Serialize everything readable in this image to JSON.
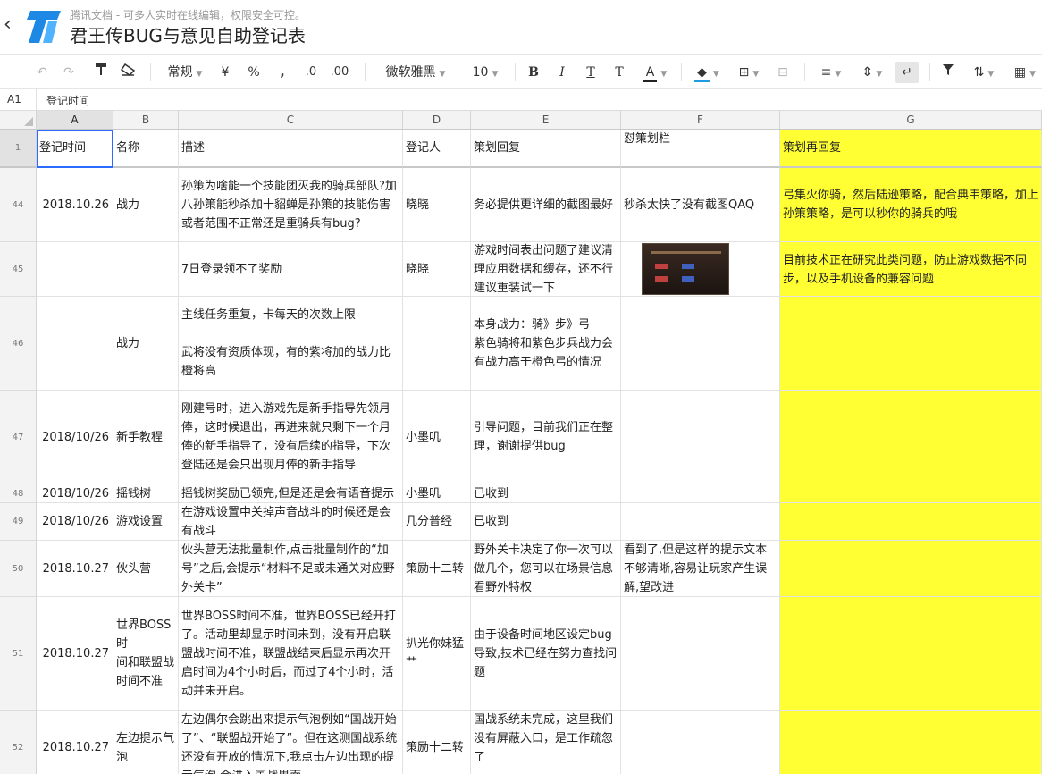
{
  "header": {
    "subtitle": "腾讯文档 - 可多人实时在线编辑，权限安全可控。",
    "title": "君王传BUG与意见自助登记表"
  },
  "toolbar": {
    "format": "常规",
    "currency": "¥",
    "percent": "%",
    "thousands": ",",
    "dec_decrease": ".0",
    "dec_increase": ".00",
    "font": "微软雅黑",
    "size": "10",
    "bold": "B",
    "italic": "I",
    "underline": "T",
    "strike": "T",
    "font_color": "A"
  },
  "formula_bar": {
    "cell_ref": "A1",
    "value": "登记时间"
  },
  "columns": [
    "A",
    "B",
    "C",
    "D",
    "E",
    "F",
    "G"
  ],
  "header_row": {
    "num": "1",
    "cells": [
      "登记时间",
      "名称",
      "描述",
      "登记人",
      "策划回复",
      "怼策划栏",
      "策划再回复"
    ]
  },
  "rows": [
    {
      "num": "44",
      "a": "2018.10.26",
      "b": "战力",
      "c": "孙策为啥能一个技能团灭我的骑兵部队?加八孙策能秒杀加十貂蝉是孙策的技能伤害或者范围不正常还是重骑兵有bug?",
      "d": "晓晓",
      "e": "务必提供更详细的截图最好",
      "f": "秒杀太快了没有截图QAQ",
      "g": "弓集火你骑，然后陆逊策略，配合典韦策略，加上孙策策略，是可以秒你的骑兵的哦"
    },
    {
      "num": "45",
      "a": "",
      "b": "",
      "c": "7日登录领不了奖励",
      "d": "晓晓",
      "e": "游戏时间表出问题了建议清理应用数据和缓存，还不行建议重装试一下",
      "f": "",
      "g": "目前技术正在研究此类问题，防止游戏数据不同步，以及手机设备的兼容问题"
    },
    {
      "num": "46",
      "a": "",
      "b": "战力",
      "c": "主线任务重复，卡每天的次数上限\n\n武将没有资质体现，有的紫将加的战力比橙将高",
      "d": "",
      "e": "本身战力：骑》步》弓\n紫色骑将和紫色步兵战力会有战力高于橙色弓的情况",
      "f": "",
      "g": ""
    },
    {
      "num": "47",
      "a": "2018/10/26",
      "b": "新手教程",
      "c": "刚建号时，进入游戏先是新手指导先领月俸，这时候退出，再进来就只剩下一个月俸的新手指导了，没有后续的指导，下次登陆还是会只出现月俸的新手指导",
      "d": "小墨叽",
      "e": "引导问题，目前我们正在整理，谢谢提供bug",
      "f": "",
      "g": ""
    },
    {
      "num": "48",
      "a": "2018/10/26",
      "b": "摇钱树",
      "c": "摇钱树奖励已领完,但是还是会有语音提示",
      "d": "小墨叽",
      "e": "已收到",
      "f": "",
      "g": ""
    },
    {
      "num": "49",
      "a": "2018/10/26",
      "b": "游戏设置",
      "c": "在游戏设置中关掉声音战斗的时候还是会有战斗",
      "d": "几分普经",
      "e": "已收到",
      "f": "",
      "g": ""
    },
    {
      "num": "50",
      "a": "2018.10.27",
      "b": "伙头营",
      "c": "伙头营无法批量制作,点击批量制作的“加号”之后,会提示“材料不足或未通关对应野外关卡”",
      "d": "策励十二转",
      "e": "野外关卡决定了你一次可以做几个，您可以在场景信息看野外特权",
      "f": "看到了,但是这样的提示文本不够清晰,容易让玩家产生误解,望改进",
      "g": ""
    },
    {
      "num": "51",
      "a": "2018.10.27",
      "b": "世界BOSS时\n间和联盟战时间不准",
      "c": "世界BOSS时间不准，世界BOSS已经开打了。活动里却显示时间未到，没有开启联盟战时间不准，联盟战结束后显示再次开启时间为4个小时后，而过了4个小时，活动并未开启。",
      "d": "扒光你妹猛艹",
      "e": "由于设备时间地区设定bug导致,技术已经在努力查找问题",
      "f": "",
      "g": ""
    },
    {
      "num": "52",
      "a": "2018.10.27",
      "b": "左边提示气泡",
      "c": "左边偶尔会跳出来提示气泡例如“国战开始了”、“联盟战开始了”。但在这测国战系统还没有开放的情况下,我点击左边出现的提示气泡,会进入国战界面。",
      "d": "策励十二转",
      "e": "国战系统未完成，这里我们没有屏蔽入口，是工作疏忽了",
      "f": "",
      "g": ""
    }
  ],
  "colors": {
    "highlight": "#ffff33",
    "selection": "#2d6bff",
    "logo": "#1e88e5"
  },
  "icons": [
    "back-icon",
    "undo-icon",
    "redo-icon",
    "format-painter-icon",
    "eraser-icon",
    "fill-color-icon",
    "borders-icon",
    "merge-icon",
    "align-left-icon",
    "valign-icon",
    "wrap-icon",
    "filter-icon",
    "sort-icon",
    "table-icon"
  ]
}
